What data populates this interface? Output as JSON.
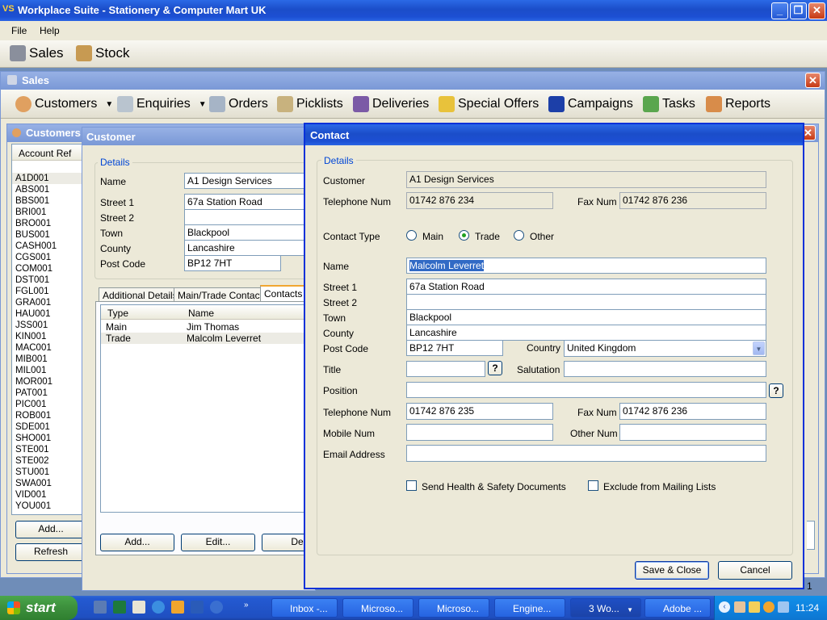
{
  "app": {
    "title": "Workplace Suite - Stationery & Computer Mart UK",
    "logo": "VS"
  },
  "menu": [
    "File",
    "Help"
  ],
  "main_toolbar": [
    {
      "label": "Sales",
      "icon": "sales-icon"
    },
    {
      "label": "Stock",
      "icon": "stock-icon"
    }
  ],
  "sales_window": {
    "title": "Sales"
  },
  "sales_toolbar": [
    {
      "label": "Customers",
      "icon": "customers-icon",
      "dropdown": true
    },
    {
      "label": "Enquiries",
      "icon": "funnel-icon",
      "dropdown": true
    },
    {
      "label": "Orders",
      "icon": "orders-icon"
    },
    {
      "label": "Picklists",
      "icon": "picklists-icon"
    },
    {
      "label": "Deliveries",
      "icon": "truck-icon"
    },
    {
      "label": "Special Offers",
      "icon": "star-icon"
    },
    {
      "label": "Campaigns",
      "icon": "flag-icon"
    },
    {
      "label": "Tasks",
      "icon": "tasks-icon"
    },
    {
      "label": "Reports",
      "icon": "reports-icon"
    }
  ],
  "customers_window": {
    "title": "Customers",
    "column": "Account Ref",
    "accounts": [
      "A1D001",
      "ABS001",
      "BBS001",
      "BRI001",
      "BRO001",
      "BUS001",
      "CASH001",
      "CGS001",
      "COM001",
      "DST001",
      "FGL001",
      "GRA001",
      "HAU001",
      "JSS001",
      "KIN001",
      "MAC001",
      "MIB001",
      "MIL001",
      "MOR001",
      "PAT001",
      "PIC001",
      "ROB001",
      "SDE001",
      "SHO001",
      "STE001",
      "STE002",
      "STU001",
      "SWA001",
      "VID001",
      "YOU001"
    ],
    "add_label": "Add...",
    "refresh_label": "Refresh",
    "pager_text": "1"
  },
  "customer_window": {
    "title": "Customer",
    "group": "Details",
    "name_label": "Name",
    "name": "A1 Design Services",
    "street1_label": "Street 1",
    "street1": "67a Station Road",
    "street2_label": "Street 2",
    "street2": "",
    "town_label": "Town",
    "town": "Blackpool",
    "county_label": "County",
    "county": "Lancashire",
    "postcode_label": "Post Code",
    "postcode": "BP12 7HT",
    "tabs": [
      "Additional Details",
      "Main/Trade Contact",
      "Contacts"
    ],
    "contacts_columns": [
      "Type",
      "Name"
    ],
    "contacts": [
      {
        "type": "Main",
        "name": "Jim Thomas"
      },
      {
        "type": "Trade",
        "name": "Malcolm Leverret"
      }
    ],
    "add_label": "Add...",
    "edit_label": "Edit...",
    "delete_label": "Dele"
  },
  "contact_dialog": {
    "title": "Contact",
    "group": "Details",
    "customer_label": "Customer",
    "customer": "A1 Design Services",
    "telephone_label": "Telephone Num",
    "telephone": "01742 876 234",
    "fax_label": "Fax Num",
    "fax": "01742 876 236",
    "contact_type_label": "Contact Type",
    "contact_types": [
      "Main",
      "Trade",
      "Other"
    ],
    "selected_type": "Trade",
    "name_label": "Name",
    "name": "Malcolm Leverret",
    "street1_label": "Street 1",
    "street1": "67a Station Road",
    "street2_label": "Street 2",
    "street2": "",
    "town_label": "Town",
    "town": "Blackpool",
    "county_label": "County",
    "county": "Lancashire",
    "postcode_label": "Post Code",
    "postcode": "BP12 7HT",
    "country_label": "Country",
    "country": "United Kingdom",
    "title_label": "Title",
    "title_value": "",
    "salutation_label": "Salutation",
    "salutation": "",
    "position_label": "Position",
    "position": "",
    "help_glyph": "?",
    "contact_tel_label": "Telephone Num",
    "contact_tel": "01742 876 235",
    "contact_fax_label": "Fax Num",
    "contact_fax": "01742 876 236",
    "mobile_label": "Mobile Num",
    "mobile": "",
    "other_label": "Other Num",
    "other": "",
    "email_label": "Email Address",
    "email": "",
    "health_safety_label": "Send Health & Safety Documents",
    "exclude_mailing_label": "Exclude from Mailing Lists",
    "save_label": "Save & Close",
    "cancel_label": "Cancel"
  },
  "taskbar": {
    "start_label": "start",
    "tasks": [
      {
        "label": "Inbox -...",
        "active": false
      },
      {
        "label": "Microso...",
        "active": false
      },
      {
        "label": "Microso...",
        "active": false
      },
      {
        "label": "Engine...",
        "active": false
      },
      {
        "label": "3 Wo...",
        "active": true
      },
      {
        "label": "Adobe ...",
        "active": false
      }
    ],
    "clock": "11:24"
  },
  "colors": {
    "accent": "#0046d5",
    "titlebar": "#1c4fd3",
    "face": "#ece9d8",
    "selection": "#316ac5"
  }
}
